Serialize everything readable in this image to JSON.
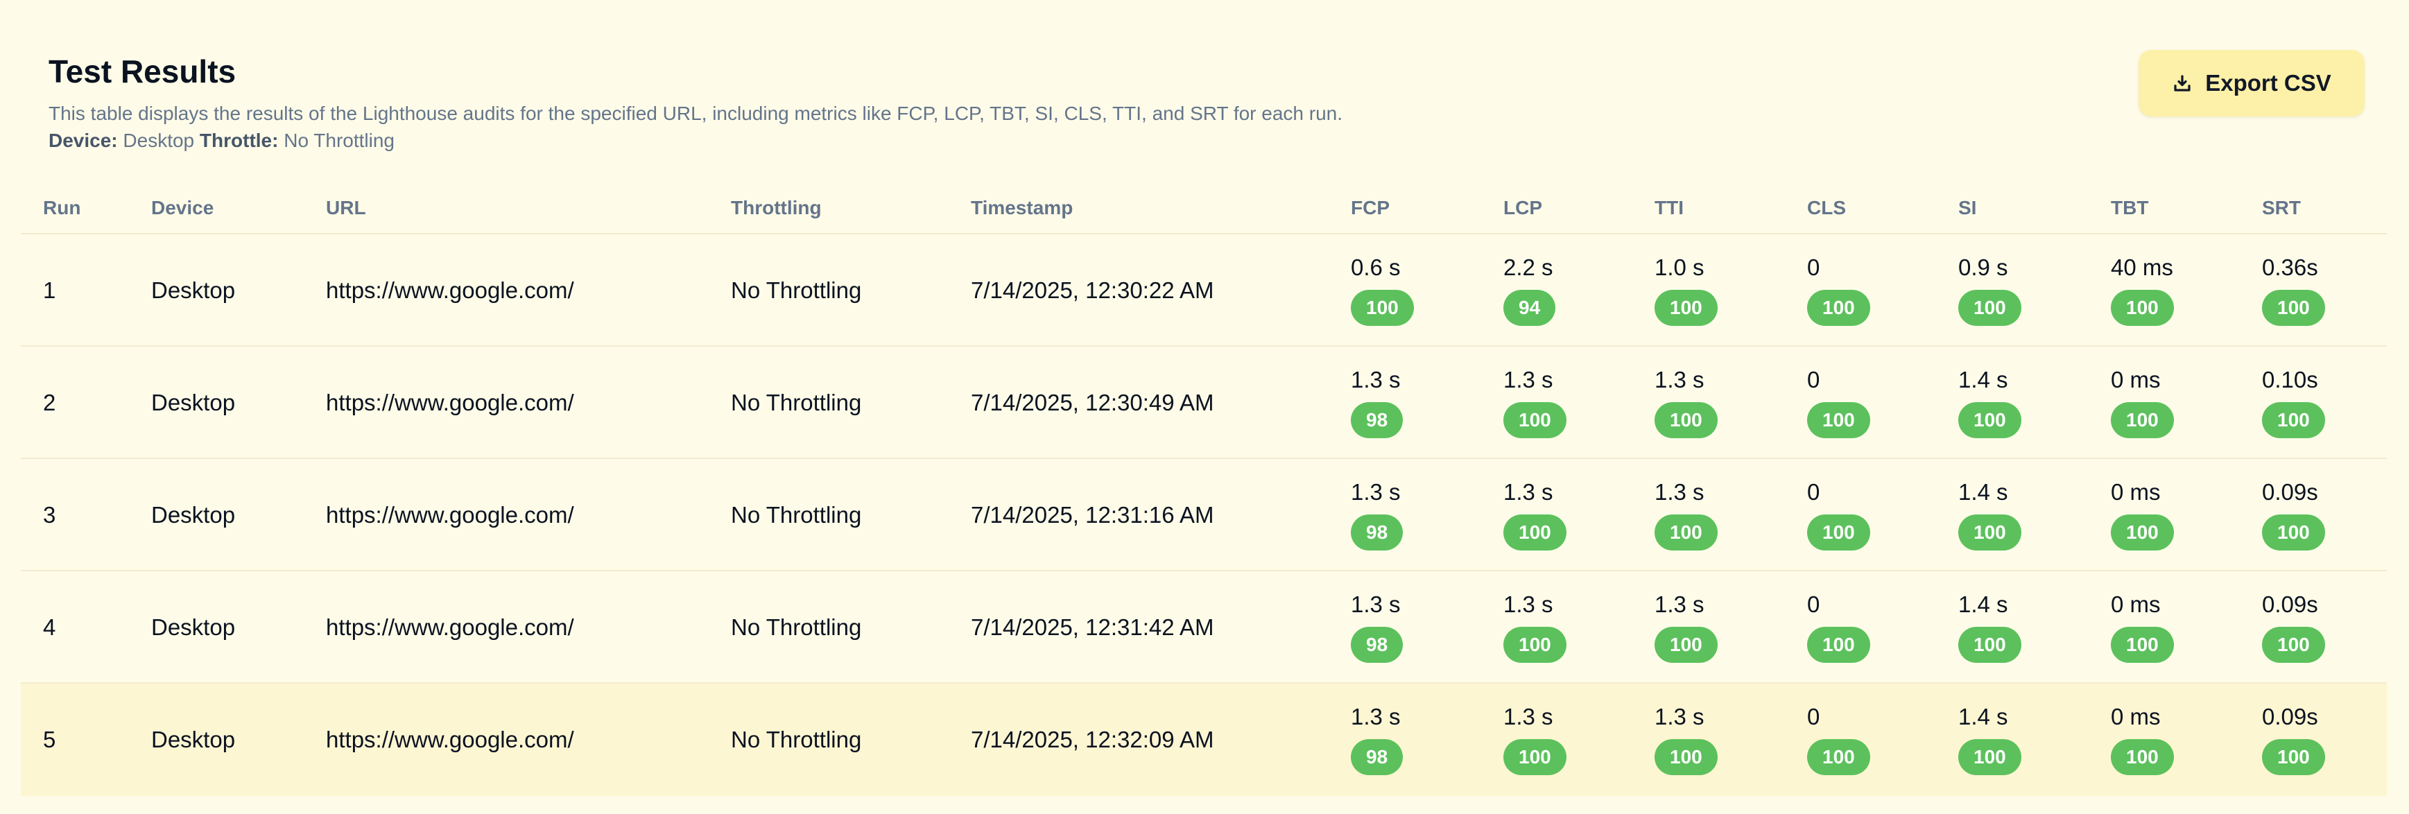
{
  "header": {
    "title": "Test Results",
    "description": "This table displays the results of the Lighthouse audits for the specified URL, including metrics like FCP, LCP, TBT, SI, CLS, TTI, and SRT for each run.",
    "device_label": "Device:",
    "device_value": "Desktop",
    "throttle_label": "Throttle:",
    "throttle_value": "No Throttling",
    "export_label": "Export CSV",
    "export_icon": "download-icon"
  },
  "columns": [
    "Run",
    "Device",
    "URL",
    "Throttling",
    "Timestamp",
    "FCP",
    "LCP",
    "TTI",
    "CLS",
    "SI",
    "TBT",
    "SRT"
  ],
  "rows": [
    {
      "run": "1",
      "device": "Desktop",
      "url": "https://www.google.com/",
      "throttling": "No Throttling",
      "timestamp": "7/14/2025, 12:30:22 AM",
      "metrics": [
        {
          "value": "0.6 s",
          "score": "100"
        },
        {
          "value": "2.2 s",
          "score": "94"
        },
        {
          "value": "1.0 s",
          "score": "100"
        },
        {
          "value": "0",
          "score": "100"
        },
        {
          "value": "0.9 s",
          "score": "100"
        },
        {
          "value": "40 ms",
          "score": "100"
        },
        {
          "value": "0.36s",
          "score": "100"
        }
      ]
    },
    {
      "run": "2",
      "device": "Desktop",
      "url": "https://www.google.com/",
      "throttling": "No Throttling",
      "timestamp": "7/14/2025, 12:30:49 AM",
      "metrics": [
        {
          "value": "1.3 s",
          "score": "98"
        },
        {
          "value": "1.3 s",
          "score": "100"
        },
        {
          "value": "1.3 s",
          "score": "100"
        },
        {
          "value": "0",
          "score": "100"
        },
        {
          "value": "1.4 s",
          "score": "100"
        },
        {
          "value": "0 ms",
          "score": "100"
        },
        {
          "value": "0.10s",
          "score": "100"
        }
      ]
    },
    {
      "run": "3",
      "device": "Desktop",
      "url": "https://www.google.com/",
      "throttling": "No Throttling",
      "timestamp": "7/14/2025, 12:31:16 AM",
      "metrics": [
        {
          "value": "1.3 s",
          "score": "98"
        },
        {
          "value": "1.3 s",
          "score": "100"
        },
        {
          "value": "1.3 s",
          "score": "100"
        },
        {
          "value": "0",
          "score": "100"
        },
        {
          "value": "1.4 s",
          "score": "100"
        },
        {
          "value": "0 ms",
          "score": "100"
        },
        {
          "value": "0.09s",
          "score": "100"
        }
      ]
    },
    {
      "run": "4",
      "device": "Desktop",
      "url": "https://www.google.com/",
      "throttling": "No Throttling",
      "timestamp": "7/14/2025, 12:31:42 AM",
      "metrics": [
        {
          "value": "1.3 s",
          "score": "98"
        },
        {
          "value": "1.3 s",
          "score": "100"
        },
        {
          "value": "1.3 s",
          "score": "100"
        },
        {
          "value": "0",
          "score": "100"
        },
        {
          "value": "1.4 s",
          "score": "100"
        },
        {
          "value": "0 ms",
          "score": "100"
        },
        {
          "value": "0.09s",
          "score": "100"
        }
      ]
    },
    {
      "run": "5",
      "device": "Desktop",
      "url": "https://www.google.com/",
      "throttling": "No Throttling",
      "timestamp": "7/14/2025, 12:32:09 AM",
      "metrics": [
        {
          "value": "1.3 s",
          "score": "98"
        },
        {
          "value": "1.3 s",
          "score": "100"
        },
        {
          "value": "1.3 s",
          "score": "100"
        },
        {
          "value": "0",
          "score": "100"
        },
        {
          "value": "1.4 s",
          "score": "100"
        },
        {
          "value": "0 ms",
          "score": "100"
        },
        {
          "value": "0.09s",
          "score": "100"
        }
      ]
    }
  ],
  "colors": {
    "background": "#fefce8",
    "badge_green": "#5cc15c",
    "button_bg": "#fdf0a8",
    "highlight_row": "#fdf6d2"
  }
}
